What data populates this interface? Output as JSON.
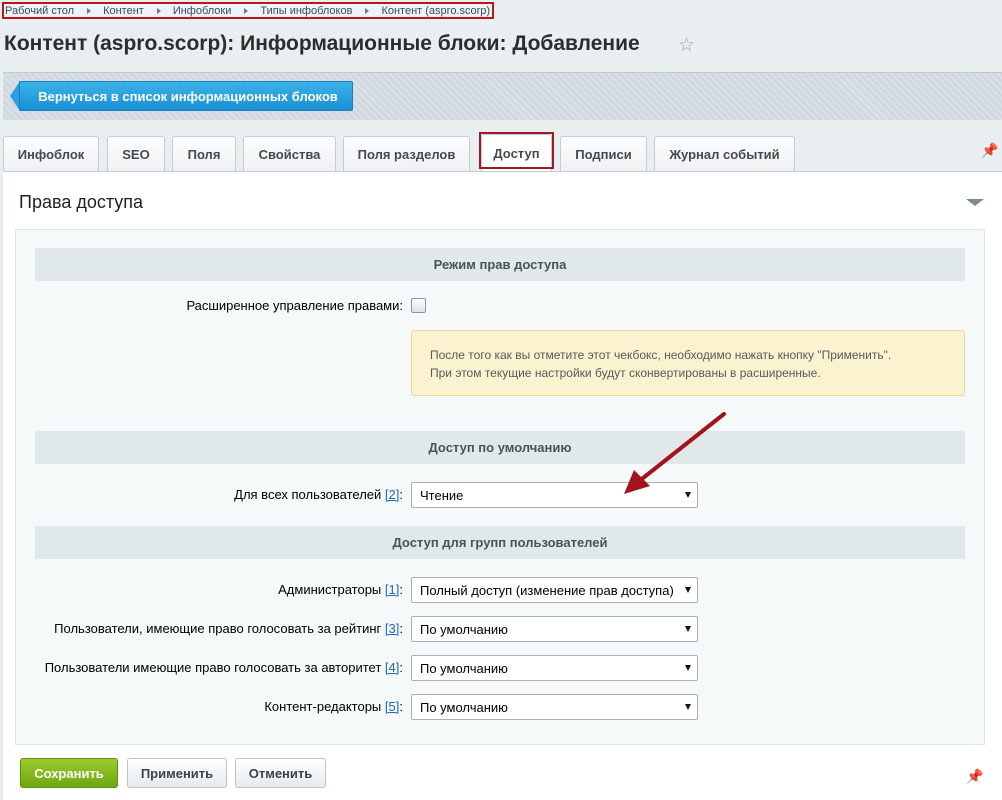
{
  "breadcrumb": [
    "Рабочий стол",
    "Контент",
    "Инфоблоки",
    "Типы инфоблоков",
    "Контент (aspro.scorp)"
  ],
  "page_title": "Контент (aspro.scorp): Информационные блоки: Добавление",
  "back_button": "Вернуться в список информационных блоков",
  "tabs": [
    "Инфоблок",
    "SEO",
    "Поля",
    "Свойства",
    "Поля разделов",
    "Доступ",
    "Подписи",
    "Журнал событий"
  ],
  "active_tab": "Доступ",
  "section_title": "Права доступа",
  "groups": {
    "mode": "Режим прав доступа",
    "default": "Доступ по умолчанию",
    "user_groups": "Доступ для групп пользователей"
  },
  "extended_label": "Расширенное управление правами:",
  "extended_checked": false,
  "notice_line1": "После того как вы отметите этот чекбокс, необходимо нажать кнопку \"Применить\".",
  "notice_line2": "При этом текущие настройки будут сконвертированы в расширенные.",
  "all_users": {
    "label": "Для всех пользователей",
    "ref": "[2]",
    "value": "Чтение"
  },
  "group_rows": [
    {
      "label": "Администраторы",
      "ref": "[1]",
      "value": "Полный доступ (изменение прав доступа)"
    },
    {
      "label": "Пользователи, имеющие право голосовать за рейтинг",
      "ref": "[3]",
      "value": "По умолчанию"
    },
    {
      "label": "Пользователи имеющие право голосовать за авторитет",
      "ref": "[4]",
      "value": "По умолчанию"
    },
    {
      "label": "Контент-редакторы",
      "ref": "[5]",
      "value": "По умолчанию"
    }
  ],
  "buttons": {
    "save": "Сохранить",
    "apply": "Применить",
    "cancel": "Отменить"
  },
  "icons": {
    "favorite": "star-icon",
    "pin": "pin-icon",
    "collapse": "chevron-down-icon"
  },
  "colors": {
    "accent_blue": "#1a8fd2",
    "save_green": "#6ea711",
    "highlight_red": "#c0141c"
  }
}
